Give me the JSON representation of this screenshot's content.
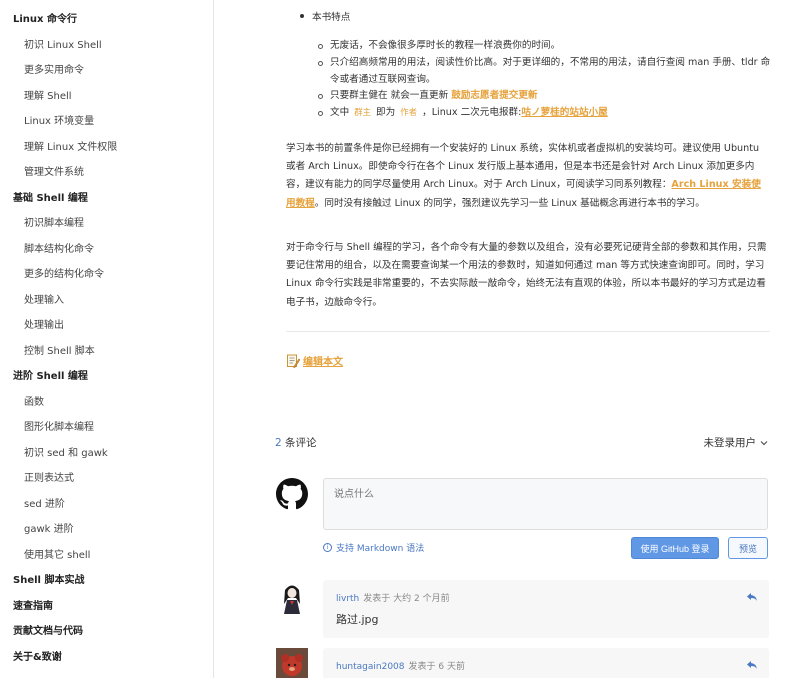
{
  "sidebar": {
    "items": [
      {
        "label": "Linux 命令行",
        "level": 0
      },
      {
        "label": "初识 Linux Shell",
        "level": 1
      },
      {
        "label": "更多实用命令",
        "level": 1
      },
      {
        "label": "理解 Shell",
        "level": 1
      },
      {
        "label": "Linux 环境变量",
        "level": 1
      },
      {
        "label": "理解 Linux 文件权限",
        "level": 1
      },
      {
        "label": "管理文件系统",
        "level": 1
      },
      {
        "label": "基础 Shell 编程",
        "level": 0
      },
      {
        "label": "初识脚本编程",
        "level": 1
      },
      {
        "label": "脚本结构化命令",
        "level": 1
      },
      {
        "label": "更多的结构化命令",
        "level": 1
      },
      {
        "label": "处理输入",
        "level": 1
      },
      {
        "label": "处理输出",
        "level": 1
      },
      {
        "label": "控制 Shell 脚本",
        "level": 1
      },
      {
        "label": "进阶 Shell 编程",
        "level": 0
      },
      {
        "label": "函数",
        "level": 1
      },
      {
        "label": "图形化脚本编程",
        "level": 1
      },
      {
        "label": "初识 sed 和 gawk",
        "level": 1
      },
      {
        "label": "正则表达式",
        "level": 1
      },
      {
        "label": "sed 进阶",
        "level": 1
      },
      {
        "label": "gawk 进阶",
        "level": 1
      },
      {
        "label": "使用其它 shell",
        "level": 1
      },
      {
        "label": "Shell 脚本实战",
        "level": 0
      },
      {
        "label": "速查指南",
        "level": 0
      },
      {
        "label": "贡献文档与代码",
        "level": 0
      },
      {
        "label": "关于&致谢",
        "level": 0
      }
    ]
  },
  "content": {
    "features_title": "本书特点",
    "features": {
      "f1": "无废话，不会像很多厚时长的教程一样浪费你的时间。",
      "f2": "只介绍高频常用的用法，阅读性价比高。对于更详细的，不常用的用法，请自行查阅 man 手册、tldr 命令或者通过互联网查询。",
      "f3_prefix": "只要群主健在 就会一直更新 ",
      "f3_link": "鼓励志愿者提交更新",
      "f4_a": "文中 ",
      "f4_code1": "群主",
      "f4_b": " 即为 ",
      "f4_code2": "作者",
      "f4_c": " ，Linux 二次元电报群:",
      "f4_link": "咕ノ萝桂的站站小屋"
    },
    "para1_a": "学习本书的前置条件是你已经拥有一个安装好的 Linux 系统，实体机或者虚拟机的安装均可。建议使用 Ubuntu 或者 Arch Linux。即使命令行在各个 Linux 发行版上基本通用，但是本书还是会针对 Arch Linux 添加更多内容，建议有能力的同学尽量使用 Arch Linux。对于 Arch Linux，可阅读学习同系列教程：",
    "para1_link": "Arch Linux 安装使用教程",
    "para1_b": "。同时没有接触过 Linux 的同学，强烈建议先学习一些 Linux 基础概念再进行本书的学习。",
    "para2": "对于命令行与 Shell 编程的学习，各个命令有大量的参数以及组合，没有必要死记硬背全部的参数和其作用，只需要记住常用的组合，以及在需要查询某一个用法的参数时，知道如何通过 man 等方式快速查询即可。同时，学习 Linux 命令行实践是非常重要的，不去实际敲一敲命令，始终无法有直观的体验，所以本书最好的学习方式是边看电子书，边敲命令行。",
    "edit_link": "编辑本文"
  },
  "comments": {
    "count": "2",
    "count_suffix": " 条评论",
    "login_label": "未登录用户",
    "placeholder": "说点什么",
    "markdown_hint": "支持 Markdown 语法",
    "github_login": "使用 GitHub 登录",
    "preview": "预览",
    "list": [
      {
        "user": "livrth",
        "meta": "发表于  大约 2 个月前",
        "body": "路过.jpg"
      },
      {
        "user": "huntagain2008",
        "meta": "发表于  6 天前",
        "body": ""
      }
    ]
  },
  "colors": {
    "accent_orange": "#e6a23c",
    "link_blue": "#4a78c2",
    "button_blue": "#6098e6"
  }
}
